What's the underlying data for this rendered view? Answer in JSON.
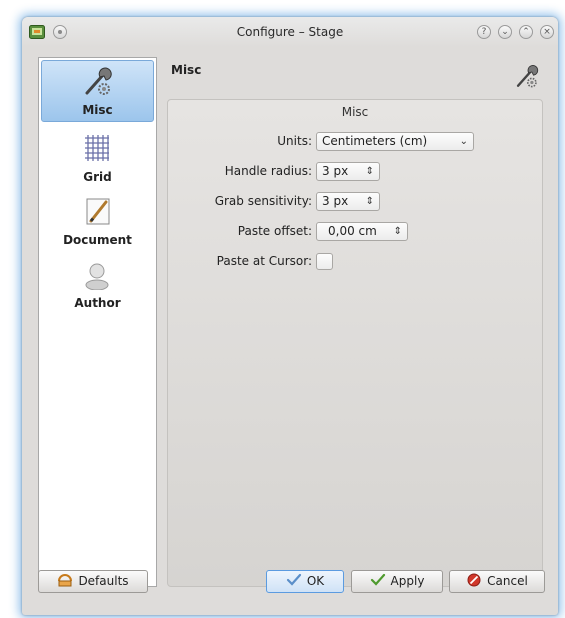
{
  "window": {
    "title": "Configure – Stage"
  },
  "sidebar": {
    "items": [
      {
        "label": "Misc",
        "icon": "wrench-icon"
      },
      {
        "label": "Grid",
        "icon": "grid-icon"
      },
      {
        "label": "Document",
        "icon": "pencil-document-icon"
      },
      {
        "label": "Author",
        "icon": "person-icon"
      }
    ]
  },
  "header": {
    "title": "Misc",
    "icon": "wrench-icon"
  },
  "group": {
    "title": "Misc"
  },
  "form": {
    "units_label": "Units:",
    "units_value": "Centimeters (cm)",
    "handle_radius_label": "Handle radius:",
    "handle_radius_value": "3 px",
    "grab_sensitivity_label": "Grab sensitivity:",
    "grab_sensitivity_value": "3 px",
    "paste_offset_label": "Paste offset:",
    "paste_offset_value": "0,00 cm",
    "paste_at_cursor_label": "Paste at Cursor:"
  },
  "buttons": {
    "defaults": "Defaults",
    "ok": "OK",
    "apply": "Apply",
    "cancel": "Cancel"
  },
  "colors": {
    "selection": "#9cc5ec",
    "window_bg": "#dedcda",
    "focus": "#5b9be0"
  }
}
